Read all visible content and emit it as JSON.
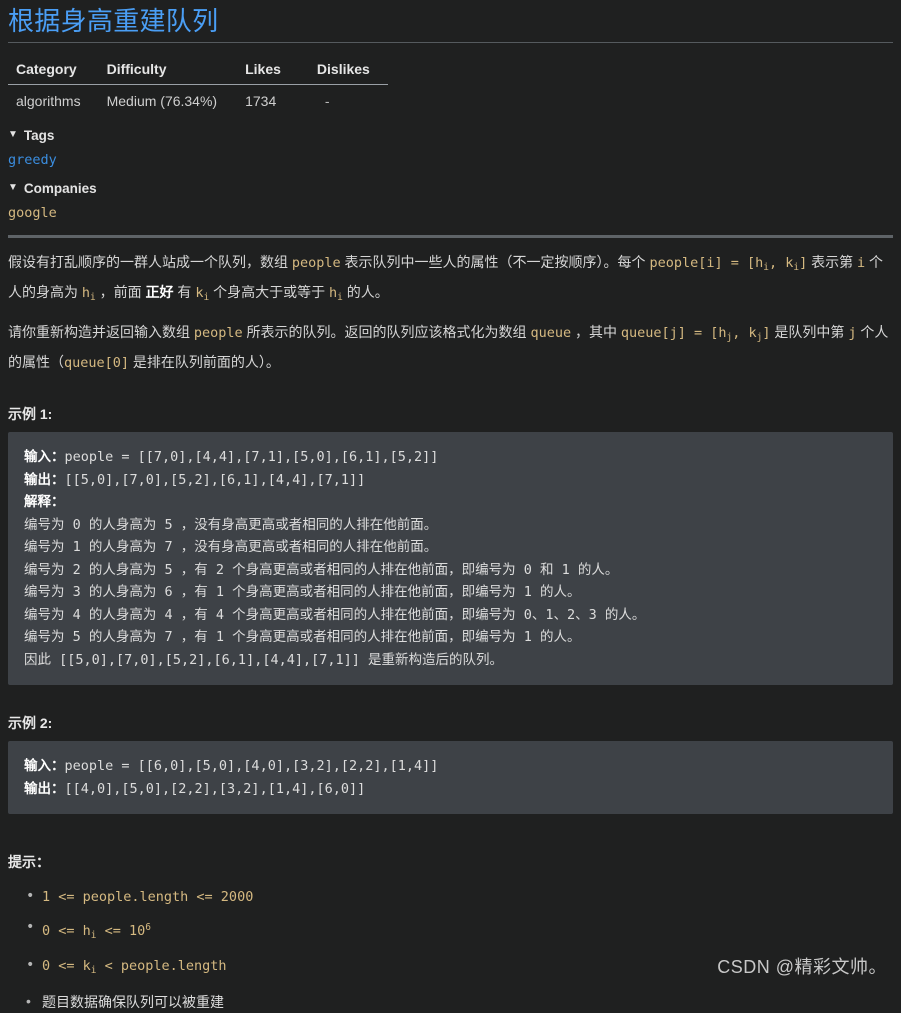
{
  "title": "根据身高重建队列",
  "meta_table": {
    "headers": [
      "Category",
      "Difficulty",
      "Likes",
      "Dislikes"
    ],
    "row": [
      "algorithms",
      "Medium (76.34%)",
      "1734",
      "-"
    ]
  },
  "tags_section": {
    "toggle_icon": "▼",
    "heading": "Tags",
    "items": [
      "greedy"
    ]
  },
  "companies_section": {
    "toggle_icon": "▼",
    "heading": "Companies",
    "items": [
      "google"
    ]
  },
  "description": {
    "p1": {
      "t1": "假设有打乱顺序的一群人站成一个队列，数组 ",
      "c1": "people",
      "t2": " 表示队列中一些人的属性（不一定按顺序）。每个 ",
      "c2": "people[i]",
      "c3": " = [h",
      "sub1": "i",
      "c4": ", k",
      "sub2": "i",
      "c5": "]",
      "t3": " 表示第 ",
      "c6": "i",
      "t4": " 个人的身高为 ",
      "c7": "h",
      "sub3": "i",
      "t5": " ，前面 ",
      "bold1": "正好",
      "t6": " 有 ",
      "c8": "k",
      "sub4": "i",
      "t7": " 个身高大于或等于 ",
      "c9": "h",
      "sub5": "i",
      "t8": " 的人。"
    },
    "p2": {
      "t1": "请你重新构造并返回输入数组 ",
      "c1": "people",
      "t2": " 所表示的队列。返回的队列应该格式化为数组 ",
      "c2": "queue",
      "t3": " ，其中 ",
      "c3": "queue[j]",
      "c4": " = [h",
      "sub1": "j",
      "c5": ", k",
      "sub2": "j",
      "c6": "]",
      "t4": " 是队列中第 ",
      "c7": "j",
      "t5": " 个人的属性（",
      "c8": "queue[0]",
      "t6": " 是排在队列前面的人）。"
    }
  },
  "example1": {
    "heading": "示例 1:",
    "input_label": "输入：",
    "input_value": "people = [[7,0],[4,4],[7,1],[5,0],[6,1],[5,2]]",
    "output_label": "输出：",
    "output_value": "[[5,0],[7,0],[5,2],[6,1],[4,4],[7,1]]",
    "explain_label": "解释：",
    "explain_lines": [
      "编号为 0 的人身高为 5 ，没有身高更高或者相同的人排在他前面。",
      "编号为 1 的人身高为 7 ，没有身高更高或者相同的人排在他前面。",
      "编号为 2 的人身高为 5 ，有 2 个身高更高或者相同的人排在他前面，即编号为 0 和 1 的人。",
      "编号为 3 的人身高为 6 ，有 1 个身高更高或者相同的人排在他前面，即编号为 1 的人。",
      "编号为 4 的人身高为 4 ，有 4 个身高更高或者相同的人排在他前面，即编号为 0、1、2、3 的人。",
      "编号为 5 的人身高为 7 ，有 1 个身高更高或者相同的人排在他前面，即编号为 1 的人。",
      "因此 [[5,0],[7,0],[5,2],[6,1],[4,4],[7,1]] 是重新构造后的队列。"
    ]
  },
  "example2": {
    "heading": "示例 2:",
    "input_label": "输入：",
    "input_value": "people = [[6,0],[5,0],[4,0],[3,2],[2,2],[1,4]]",
    "output_label": "输出：",
    "output_value": "[[4,0],[5,0],[2,2],[3,2],[1,4],[6,0]]"
  },
  "hints": {
    "heading": "提示：",
    "items": [
      {
        "kind": "code",
        "text": "1 <= people.length <= 2000"
      },
      {
        "kind": "code_sub_sup",
        "pre": "0 <= h",
        "sub": "i",
        "mid": " <= 10",
        "sup": "6"
      },
      {
        "kind": "code_sub",
        "pre": "0 <= k",
        "sub": "i",
        "post": " < people.length"
      },
      {
        "kind": "plain",
        "text": "题目数据确保队列可以被重建"
      }
    ]
  },
  "watermark": "CSDN @精彩文帅。"
}
